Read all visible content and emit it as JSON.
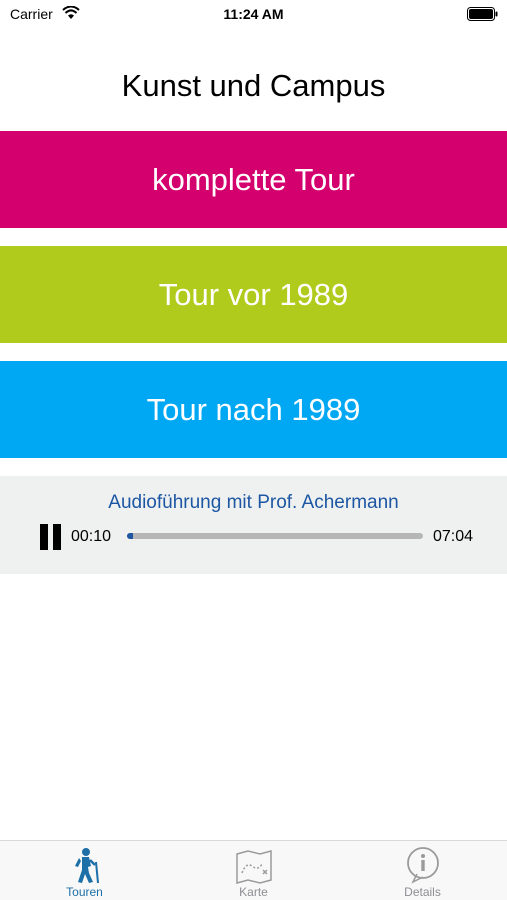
{
  "status_bar": {
    "carrier": "Carrier",
    "time": "11:24 AM"
  },
  "page": {
    "title": "Kunst und Campus"
  },
  "tours": [
    {
      "label": "komplette Tour",
      "color": "#d4006e"
    },
    {
      "label": "Tour vor 1989",
      "color": "#b1cb1c"
    },
    {
      "label": "Tour nach 1989",
      "color": "#00a8f3"
    }
  ],
  "audio": {
    "title": "Audioführung mit Prof. Achermann",
    "current_time": "00:10",
    "total_time": "07:04",
    "progress": 0.02,
    "accent_color": "#1d56a3"
  },
  "tab_bar": {
    "tabs": [
      {
        "label": "Touren",
        "icon": "hiker-icon",
        "active": true
      },
      {
        "label": "Karte",
        "icon": "map-icon",
        "active": false
      },
      {
        "label": "Details",
        "icon": "info-icon",
        "active": false
      }
    ]
  }
}
